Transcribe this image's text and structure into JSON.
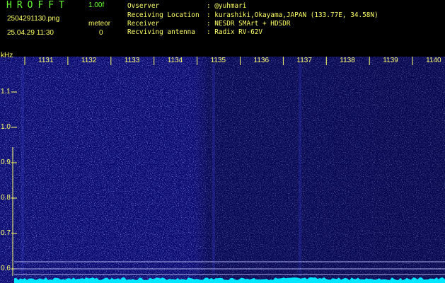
{
  "header": {
    "app_title": "HROFFT",
    "app_version": "1.00f",
    "filename": "2504291130.png",
    "datetime": "25.04.29 11:30",
    "meteor_label": "meteor",
    "meteor_count": "0",
    "info": [
      {
        "key": "Ovserver",
        "value": ": @yuhmari"
      },
      {
        "key": "Receiving Location",
        "value": ": kurashiki,Okayama,JAPAN (133.77E, 34.58N)"
      },
      {
        "key": "Receiver",
        "value": ": NESDR SMArt + HDSDR"
      },
      {
        "key": "Recviving antenna",
        "value": ": Radix RV-62V"
      }
    ]
  },
  "spectrogram": {
    "y_unit": "kHz",
    "y_ticks": [
      "1.1",
      "1.0",
      "0.9",
      "0.8",
      "0.7",
      "0.6"
    ],
    "time_ticks": [
      "1131",
      "1132",
      "1133",
      "1134",
      "1135",
      "1136",
      "1137",
      "1138",
      "1139",
      "1140"
    ],
    "colors": {
      "background": "#0a0a6e",
      "noise": "#3c46e6",
      "text": "#ffff66",
      "cyan_band": "#00e6ff",
      "title_green": "#66ff33"
    }
  }
}
